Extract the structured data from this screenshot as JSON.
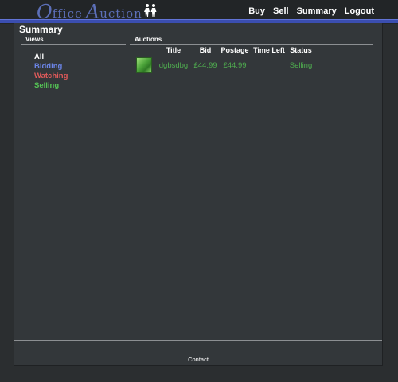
{
  "logo": {
    "first_initial": "O",
    "first_rest": "ffice",
    "second_initial": "A",
    "second_rest": "uction"
  },
  "nav": [
    {
      "label": "Buy"
    },
    {
      "label": "Sell"
    },
    {
      "label": "Summary"
    },
    {
      "label": "Logout"
    }
  ],
  "page": {
    "title": "Summary"
  },
  "views": {
    "heading": "Views",
    "items": [
      {
        "label": "All",
        "color": "#ffffff"
      },
      {
        "label": "Bidding",
        "color": "#6b84e6"
      },
      {
        "label": "Watching",
        "color": "#e05a5a"
      },
      {
        "label": "Selling",
        "color": "#55c455"
      }
    ]
  },
  "auctions": {
    "heading": "Auctions",
    "columns": [
      "",
      "Title",
      "Bid",
      "Postage",
      "Time Left",
      "Status"
    ],
    "rows": [
      {
        "image": "leaf-thumbnail",
        "title": "dgbsdbg",
        "bid": "£44.99",
        "postage": "£44.99",
        "time_left": "",
        "status": "Selling"
      }
    ]
  },
  "footer": {
    "contact": "Contact"
  },
  "colors": {
    "accent_bar": "#3b4eb0",
    "selling_green": "#4fae4f",
    "logo_blue": "#5c6fb8"
  }
}
